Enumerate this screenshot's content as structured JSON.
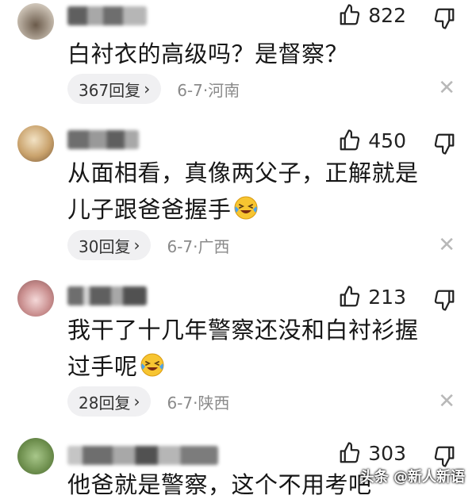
{
  "comments": [
    {
      "likes": "822",
      "text": "白衬衣的高级吗？是督察？",
      "emoji": "",
      "replies": "367回复",
      "date": "6-7",
      "location": "河南"
    },
    {
      "likes": "450",
      "text": "从面相看，真像两父子，正解就是儿子跟爸爸握手",
      "emoji": "laughing-crying",
      "replies": "30回复",
      "date": "6-7",
      "location": "广西"
    },
    {
      "likes": "213",
      "text": "我干了十几年警察还没和白衬衫握过手呢",
      "emoji": "laughing-crying",
      "replies": "28回复",
      "date": "6-7",
      "location": "陕西"
    },
    {
      "likes": "303",
      "text": "他爸就是警察，这个不用考吧",
      "emoji": "",
      "replies": "",
      "date": "",
      "location": ""
    }
  ],
  "separator": "·",
  "watermark": "头条 @新人新语",
  "icons": {
    "like": "thumbs-up-icon",
    "dislike": "thumbs-down-icon",
    "chevron": "chevron-right-icon",
    "close": "close-icon"
  }
}
